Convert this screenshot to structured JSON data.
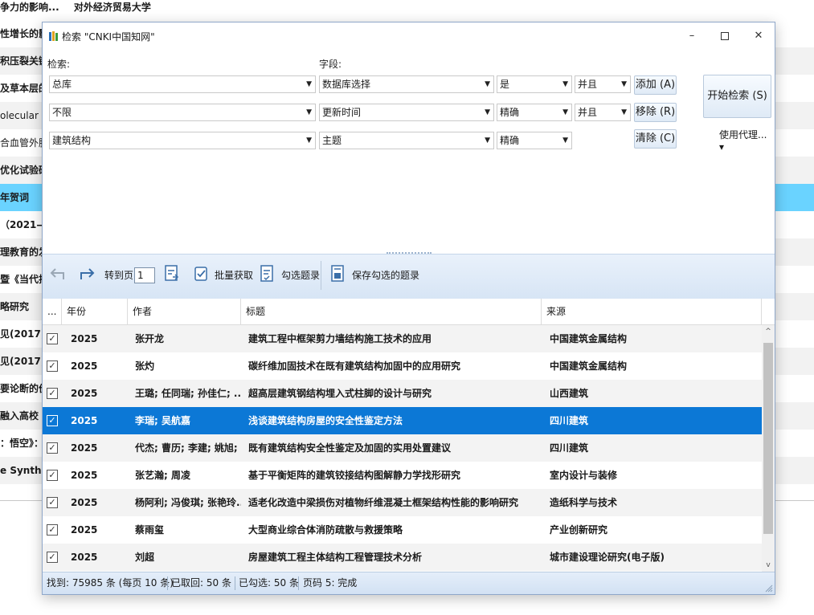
{
  "background": {
    "top_left": "争力的影响...",
    "top_right": "对外经济贸易大学",
    "rows": [
      "性增长的影",
      "积压裂关键",
      "及草本层的",
      "olecular m",
      "合血管外肺",
      "优化试验研",
      "年贺词",
      "（2021—",
      "理教育的发",
      "暨《当代排",
      "略研究",
      "见(2017)",
      "见(2017)",
      "要论断的价",
      "融入高校",
      "：悟空》：",
      "e Synthes"
    ]
  },
  "dialog": {
    "title": "检索 \"CNKI中国知网\"",
    "search_label": "检索:",
    "field_label": "字段:",
    "criteria": [
      {
        "scope": "总库",
        "field": "数据库选择",
        "match": "是",
        "logic": "并且",
        "button": "添加 (A)"
      },
      {
        "scope": "不限",
        "field": "更新时间",
        "match": "精确",
        "logic": "并且",
        "button": "移除 (R)"
      },
      {
        "scope": "建筑结构",
        "field": "主题",
        "match": "精确",
        "logic": "",
        "button": "清除 (C)"
      }
    ],
    "start_button": "开始检索 (S)",
    "proxy_label": "使用代理... ▾",
    "toolbar": {
      "goto_label": "转到页",
      "page_value": "1",
      "batch_label": "批量获取",
      "check_label": "勾选题录",
      "save_label": "保存勾选的题录"
    },
    "columns": [
      "...",
      "年份",
      "作者",
      "标题",
      "来源"
    ],
    "rows": [
      {
        "year": "2025",
        "author": "张开龙",
        "title": "建筑工程中框架剪力墙结构施工技术的应用",
        "source": "中国建筑金属结构"
      },
      {
        "year": "2025",
        "author": "张灼",
        "title": "碳纤维加固技术在既有建筑结构加固中的应用研究",
        "source": "中国建筑金属结构"
      },
      {
        "year": "2025",
        "author": "王璐; 任同瑞; 孙佳仁; ...",
        "title": "超高层建筑钢结构埋入式柱脚的设计与研究",
        "source": "山西建筑"
      },
      {
        "year": "2025",
        "author": "李瑞; 吴航嘉",
        "title": "浅谈建筑结构房屋的安全性鉴定方法",
        "source": "四川建筑"
      },
      {
        "year": "2025",
        "author": "代杰; 曹历; 李建; 姚旭; ...",
        "title": "既有建筑结构安全性鉴定及加固的实用处置建议",
        "source": "四川建筑"
      },
      {
        "year": "2025",
        "author": "张艺瀚; 周凌",
        "title": "基于平衡矩阵的建筑铰接结构图解静力学找形研究",
        "source": "室内设计与装修"
      },
      {
        "year": "2025",
        "author": "杨阿利; 冯俊琪; 张艳玲...",
        "title": "适老化改造中梁损伤对植物纤维混凝土框架结构性能的影响研究",
        "source": "造纸科学与技术"
      },
      {
        "year": "2025",
        "author": "蔡雨玺",
        "title": "大型商业综合体消防疏散与救援策略",
        "source": "产业创新研究"
      },
      {
        "year": "2025",
        "author": "刘超",
        "title": "房屋建筑工程主体结构工程管理技术分析",
        "source": "城市建设理论研究(电子版)"
      }
    ],
    "selected_row": 3,
    "check_mark": "✓",
    "status": {
      "found": "找到: 75985 条 (每页 10 条)",
      "fetched": "已取回: 50 条",
      "checked": "已勾选: 50 条",
      "page": "页码 5: 完成"
    },
    "colors": {
      "accent": "#0c78d6",
      "bg_selected": "#6ad3ff"
    }
  }
}
